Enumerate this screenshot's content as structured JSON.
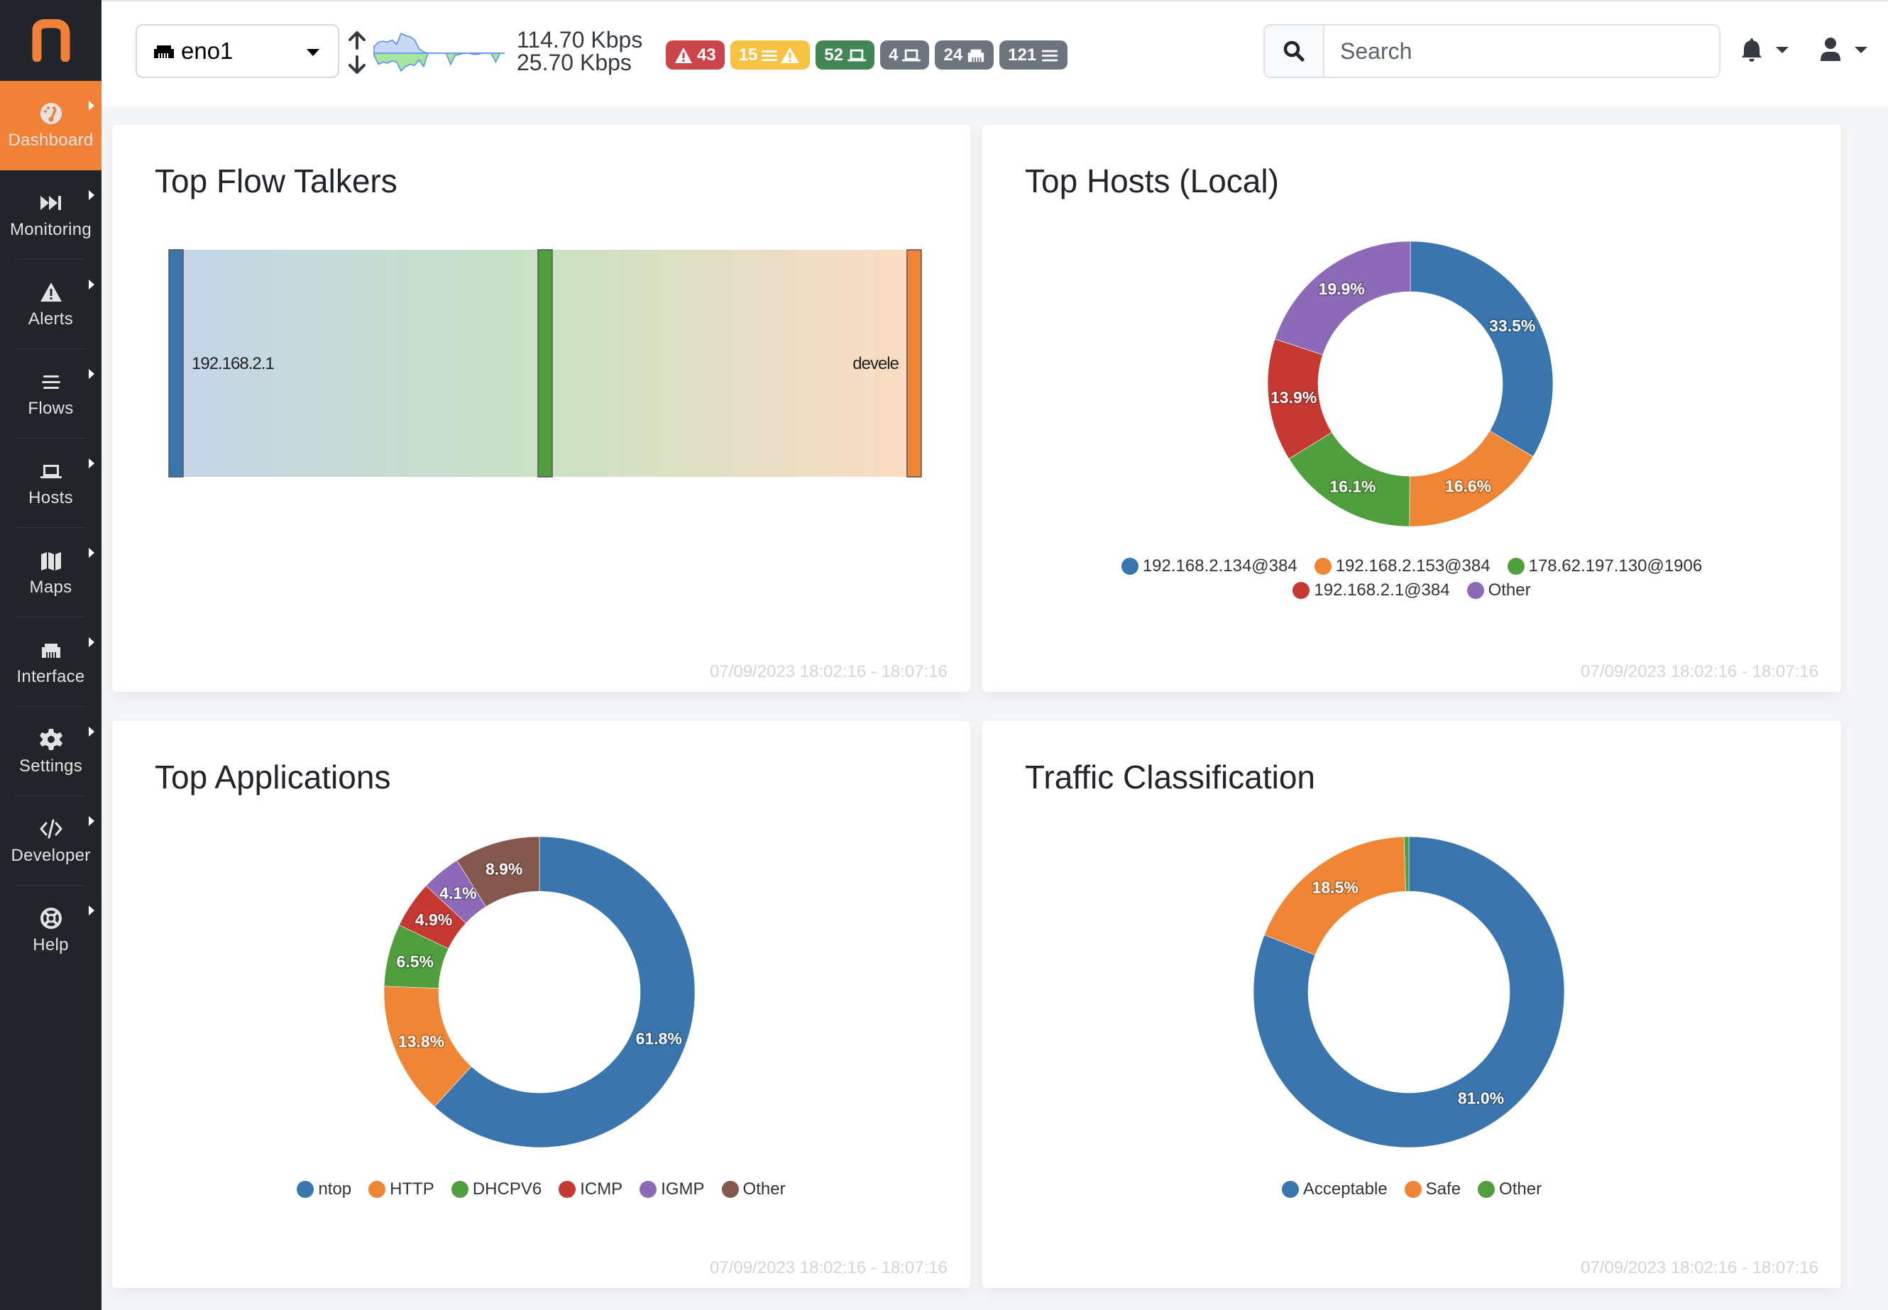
{
  "sidebar": {
    "logo": "n",
    "items": [
      {
        "label": "Dashboard",
        "icon": "gauge-icon",
        "active": true
      },
      {
        "label": "Monitoring",
        "icon": "fast-forward-icon"
      },
      {
        "label": "Alerts",
        "icon": "warning-icon"
      },
      {
        "label": "Flows",
        "icon": "bars-icon"
      },
      {
        "label": "Hosts",
        "icon": "laptop-icon"
      },
      {
        "label": "Maps",
        "icon": "map-icon"
      },
      {
        "label": "Interface",
        "icon": "ethernet-icon"
      },
      {
        "label": "Settings",
        "icon": "gear-icon"
      },
      {
        "label": "Developer",
        "icon": "code-icon"
      },
      {
        "label": "Help",
        "icon": "lifebuoy-icon"
      }
    ]
  },
  "topbar": {
    "interface": "eno1",
    "upload_rate": "114.70 Kbps",
    "download_rate": "25.70 Kbps",
    "sparkline": {
      "upload": [
        3,
        5,
        5.5,
        5,
        6,
        4,
        9,
        8,
        7.5,
        6,
        2,
        0.5,
        0,
        0,
        0,
        0,
        0,
        0,
        0,
        0,
        0,
        0,
        0,
        0,
        0,
        0,
        0,
        0,
        0,
        0
      ],
      "download": [
        1,
        5,
        4,
        4.5,
        3.5,
        4,
        8,
        6,
        5,
        5.5,
        3,
        6,
        0,
        0,
        0,
        0,
        0,
        5,
        1,
        0.5,
        0,
        0,
        0.5,
        0.5,
        0,
        0,
        0,
        4,
        0,
        0
      ]
    },
    "badges": [
      {
        "value": "43",
        "icon": "warning-icon",
        "icon_first": true,
        "color": "#cb444a",
        "meaning": "engaged-alerts"
      },
      {
        "value": "15",
        "icon": "flows-warning-icon",
        "color": "#f7c244",
        "meaning": "flows-with-alerts"
      },
      {
        "value": "52",
        "icon": "laptop-icon",
        "color": "#428753",
        "meaning": "local-hosts"
      },
      {
        "value": "4",
        "icon": "laptop-icon",
        "color": "#6c757d",
        "meaning": "remote-hosts"
      },
      {
        "value": "24",
        "icon": "ethernet-icon",
        "color": "#6c757d",
        "meaning": "devices"
      },
      {
        "value": "121",
        "icon": "bars-icon",
        "color": "#6c757d",
        "meaning": "flows"
      }
    ],
    "search": {
      "placeholder": "Search",
      "value": ""
    }
  },
  "cards": {
    "flow_talkers": {
      "title": "Top Flow Talkers",
      "footer": "07/09/2023 18:02:16 - 18:07:16"
    },
    "top_hosts": {
      "title": "Top Hosts (Local)",
      "footer": "07/09/2023 18:02:16 - 18:07:16"
    },
    "top_apps": {
      "title": "Top Applications",
      "footer": "07/09/2023 18:02:16 - 18:07:16"
    },
    "traffic_class": {
      "title": "Traffic Classification",
      "footer": "07/09/2023 18:02:16 - 18:07:16"
    }
  },
  "chart_data": [
    {
      "type": "sankey",
      "title": "Top Flow Talkers",
      "nodes": [
        {
          "name": "192.168.2.1",
          "color": "#3a75ae",
          "label_visible": true
        },
        {
          "name": "",
          "color": "#519e3e",
          "label_visible": false
        },
        {
          "name": "devele",
          "color": "#ef8636",
          "label_visible": true
        }
      ],
      "links": [
        {
          "source": 0,
          "target": 1,
          "value": 1
        },
        {
          "source": 1,
          "target": 2,
          "value": 1
        }
      ]
    },
    {
      "type": "pie",
      "donut": true,
      "title": "Top Hosts (Local)",
      "categories": [
        "192.168.2.134@384",
        "192.168.2.153@384",
        "178.62.197.130@1906",
        "192.168.2.1@384",
        "Other"
      ],
      "values": [
        33.5,
        16.6,
        16.1,
        13.9,
        19.9
      ],
      "labels": [
        "33.5%",
        "16.6%",
        "16.1%",
        "13.9%",
        "19.9%"
      ],
      "colors": [
        "#3a75ae",
        "#ef8636",
        "#519e3e",
        "#c53932",
        "#8d6ab8"
      ],
      "legend": "bottom"
    },
    {
      "type": "pie",
      "donut": true,
      "title": "Top Applications",
      "categories": [
        "ntop",
        "HTTP",
        "DHCPV6",
        "ICMP",
        "IGMP",
        "Other"
      ],
      "values": [
        61.8,
        13.8,
        6.5,
        4.9,
        4.1,
        8.9
      ],
      "labels": [
        "61.8%",
        "13.8%",
        "6.5%",
        "4.9%",
        "4.1%",
        "8.9%"
      ],
      "colors": [
        "#3a75ae",
        "#ef8636",
        "#519e3e",
        "#c53932",
        "#8d6ab8",
        "#84584e"
      ],
      "legend": "bottom"
    },
    {
      "type": "pie",
      "donut": true,
      "title": "Traffic Classification",
      "categories": [
        "Acceptable",
        "Safe",
        "Other"
      ],
      "values": [
        81.0,
        18.5,
        0.5
      ],
      "labels": [
        "81.0%",
        "18.5%",
        ""
      ],
      "colors": [
        "#3a75ae",
        "#ef8636",
        "#519e3e"
      ],
      "legend": "bottom"
    }
  ]
}
